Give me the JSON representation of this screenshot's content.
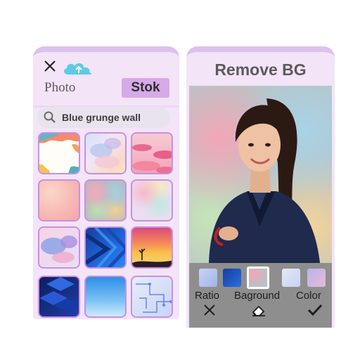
{
  "left_panel": {
    "tabs": {
      "photo": "Photo",
      "stok": "Stok"
    },
    "search": {
      "value": "Blue grunge wall"
    },
    "icons": [
      "close-icon",
      "cloud-upload-icon",
      "search-icon"
    ]
  },
  "right_panel": {
    "title": "Remove BG",
    "tools": {
      "ratio": "Ratio",
      "background": "Baground",
      "color": "Color"
    },
    "icons": [
      "close-icon",
      "eraser-icon",
      "checkmark-icon"
    ]
  },
  "colors": {
    "panel_bg": "#f3e4f8",
    "accent": "#d6a9e8",
    "tile_border": "#c98fe0",
    "toolbar_bg": "#8e8e8e"
  }
}
